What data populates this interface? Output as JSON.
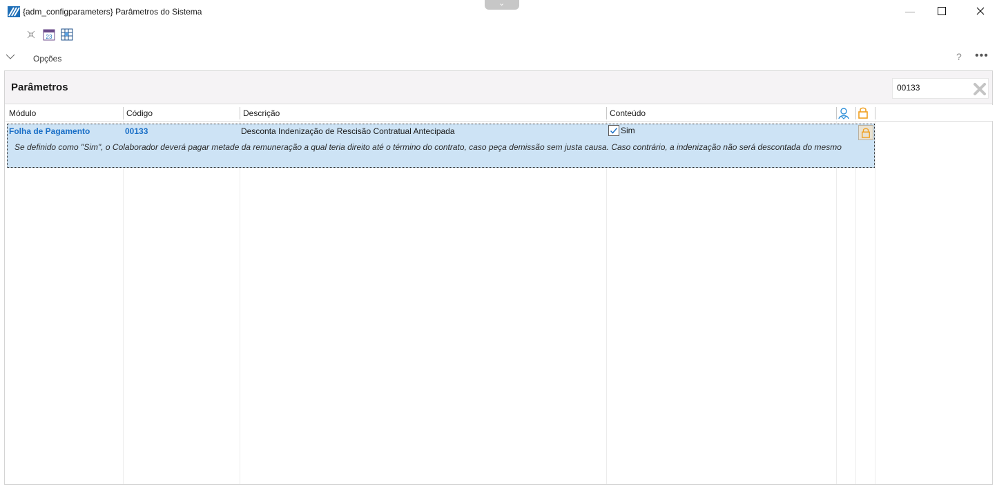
{
  "window": {
    "title": "{adm_configparameters}  Parâmetros do Sistema",
    "logo_icon": "app-logo-icon",
    "minimize_glyph": "—",
    "maximize_glyph": "☐",
    "close_glyph": "✕"
  },
  "toolbar": {
    "items": [
      {
        "icon": "collapse-icon"
      },
      {
        "icon": "calendar-icon",
        "text": "23"
      },
      {
        "icon": "grid-icon"
      }
    ]
  },
  "options": {
    "label": "Opções",
    "help": "?",
    "more": "•••"
  },
  "panel": {
    "title": "Parâmetros",
    "search_value": "00133"
  },
  "grid": {
    "columns": [
      "Módulo",
      "Código",
      "Descrição",
      "Conteúdo"
    ],
    "icon_columns": [
      "user-icon",
      "lock-icon"
    ],
    "rows": [
      {
        "modulo": "Folha de Pagamento",
        "codigo": "00133",
        "descricao": "Desconta Indenização de Rescisão Contratual Antecipada",
        "conteudo": "Sim",
        "checked": true,
        "note": "Se definido como \"Sim\", o Colaborador deverá pagar metade da remuneração a qual teria direito até o término do contrato, caso peça demissão sem justa causa. Caso contrário, a indenização não será descontada do mesmo"
      }
    ]
  },
  "colors": {
    "selection": "#cde3f5",
    "link_blue": "#1a6fc7",
    "lock_orange": "#f0a020",
    "user_blue": "#2f8fd8"
  }
}
